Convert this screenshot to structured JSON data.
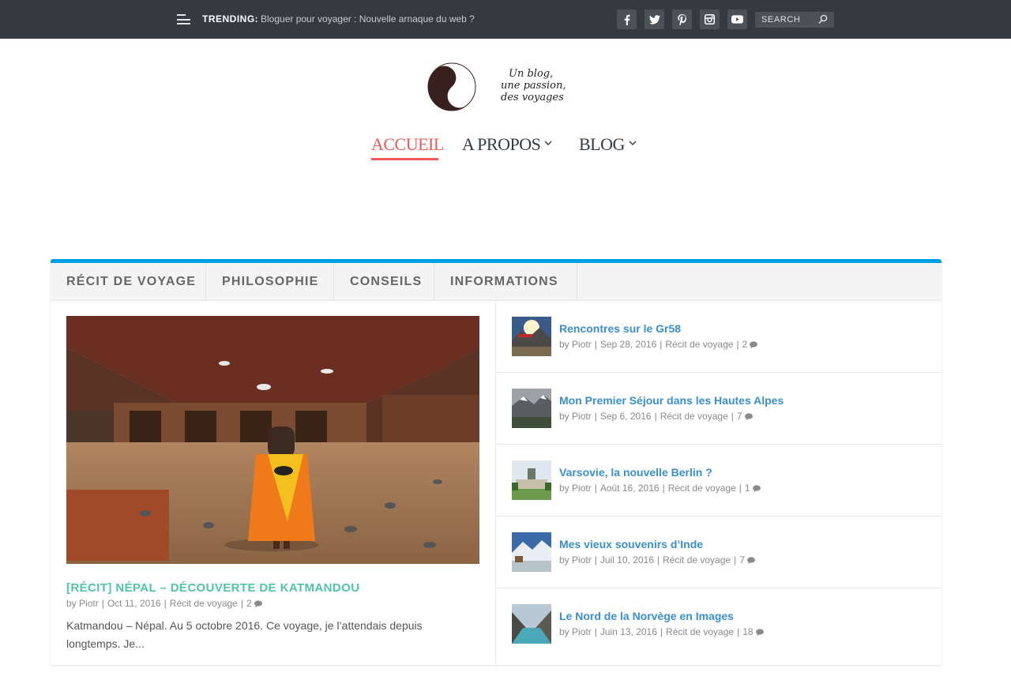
{
  "topbar": {
    "trending_label": "TRENDING:",
    "trending_text": "Bloguer pour voyager : Nouvelle arnaque du web ?",
    "social_icons": [
      "facebook-icon",
      "twitter-icon",
      "pinterest-icon",
      "instagram-icon",
      "youtube-icon"
    ],
    "search_placeholder": "SEARCH"
  },
  "logo": {
    "line1": "Un blog,",
    "line2": "une passion,",
    "line3": "des voyages"
  },
  "nav": {
    "items": [
      {
        "label": "ACCUEIL",
        "active": true
      },
      {
        "label": "A PROPOS",
        "has_dropdown": true
      },
      {
        "label": "BLOG",
        "has_dropdown": true
      }
    ]
  },
  "tabs": {
    "items": [
      "RÉCIT DE VOYAGE",
      "PHILOSOPHIE",
      "CONSEILS",
      "INFORMATIONS"
    ],
    "accent_color": "#00a1e4"
  },
  "featured": {
    "title": "[RÉCIT] NÉPAL – DÉCOUVERTE DE KATMANDOU",
    "by": "by",
    "author": "Piotr",
    "date": "Oct 11, 2016",
    "category": "Récit de voyage",
    "comments": "2",
    "excerpt": " Katmandou – Népal. Au 5 octobre 2016. Ce voyage, je l’attendais depuis longtemps. Je..."
  },
  "posts": [
    {
      "title": "Rencontres sur le Gr58",
      "by": "by",
      "author": "Piotr",
      "date": "Sep 28, 2016",
      "category": "Récit de voyage",
      "comments": "2"
    },
    {
      "title": "Mon Premier Séjour dans les Hautes Alpes",
      "by": "by",
      "author": "Piotr",
      "date": "Sep 6, 2016",
      "category": "Récit de voyage",
      "comments": "7"
    },
    {
      "title": "Varsovie, la nouvelle Berlin ?",
      "by": "by",
      "author": "Piotr",
      "date": "Août 16, 2016",
      "category": "Récit de voyage",
      "comments": "1"
    },
    {
      "title": "Mes vieux souvenirs d’Inde",
      "by": "by",
      "author": "Piotr",
      "date": "Juil 10, 2016",
      "category": "Récit de voyage",
      "comments": "7"
    },
    {
      "title": "Le Nord de la Norvège en Images",
      "by": "by",
      "author": "Piotr",
      "date": "Juin 13, 2016",
      "category": "Récit de voyage",
      "comments": "18"
    }
  ],
  "colors": {
    "topbar_bg": "#333a40",
    "nav_active": "#ef5a5a",
    "featured_title": "#4fc6a6",
    "post_title": "#3a8fcf"
  }
}
